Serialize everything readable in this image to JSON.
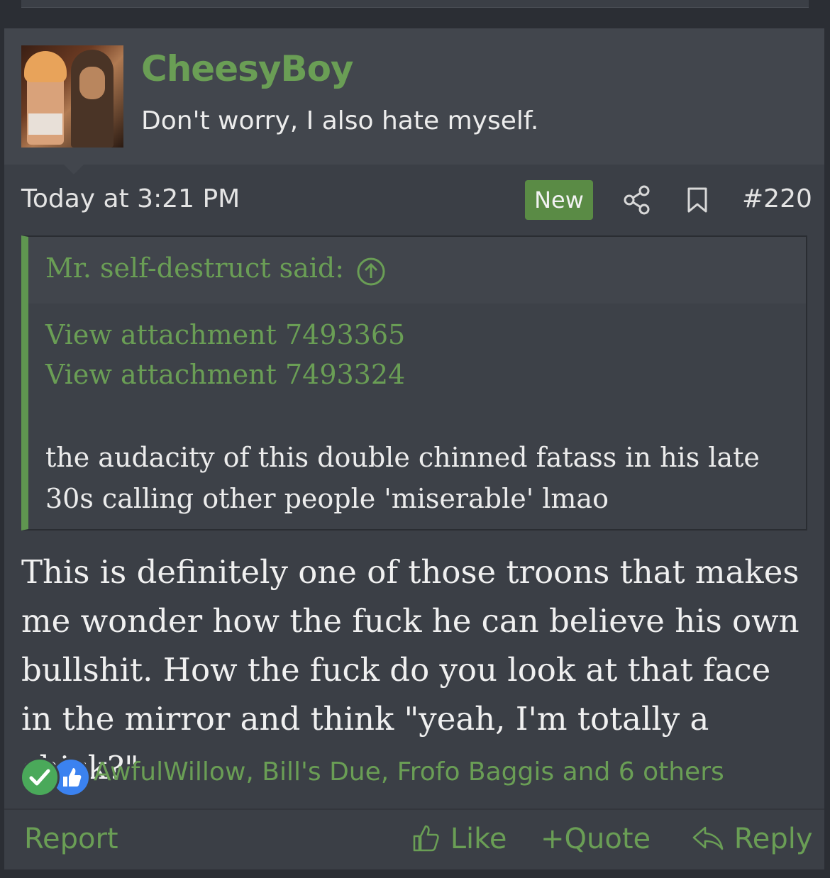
{
  "user": {
    "name": "CheesyBoy",
    "title": "Don't worry, I also hate myself."
  },
  "meta": {
    "timestamp": "Today at 3:21 PM",
    "badge": "New",
    "post_number": "#220"
  },
  "quote": {
    "author": "Mr. self-destruct said:",
    "attachments": [
      "View attachment 7493365",
      "View attachment 7493324"
    ],
    "text": "the audacity of this double chinned fatass in his late 30s calling other people 'miserable' lmao"
  },
  "body": {
    "text": "This is definitely one of those troons that makes me wonder how the fuck he can believe his own bullshit. How the fuck do you look at that face in the mirror and think \"yeah, I'm totally a chick?\""
  },
  "reactions": {
    "names": "AwfulWillow, Bill's Due, Frofo Baggis and 6 others",
    "icons": [
      "check-reaction-icon",
      "thumbs-up-reaction-icon"
    ]
  },
  "footer": {
    "report": "Report",
    "like": "Like",
    "quote": "Quote",
    "reply": "Reply"
  },
  "colors": {
    "accent_green": "#6a9e55",
    "badge_green": "#5a8b45",
    "quote_border": "#5f9650",
    "post_bg": "#3b3f46",
    "header_bg": "#42464d"
  }
}
